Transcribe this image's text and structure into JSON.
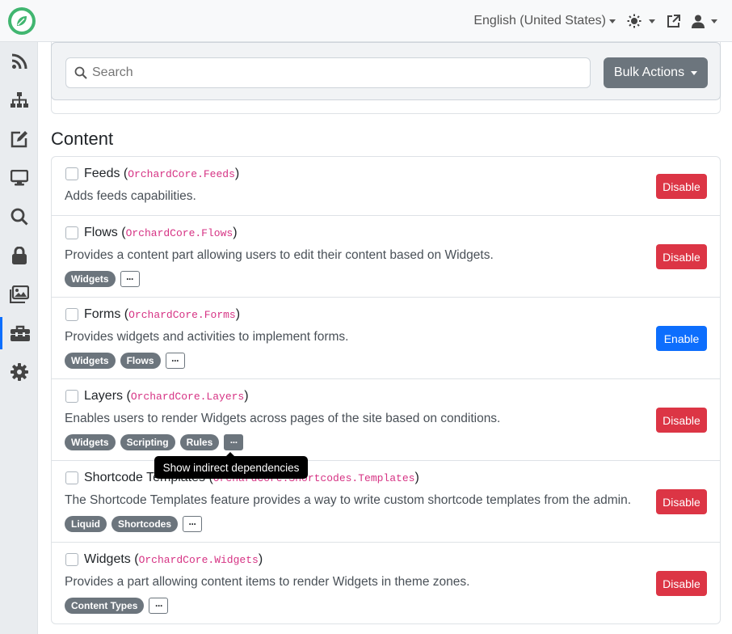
{
  "navbar": {
    "language": "English (United States)",
    "icons": [
      "theme-toggle-icon",
      "external-link-icon",
      "user-icon"
    ]
  },
  "sidebar": {
    "items": [
      {
        "name": "feeds-icon"
      },
      {
        "name": "sitemap-icon"
      },
      {
        "name": "content-edit-icon"
      },
      {
        "name": "design-monitor-icon"
      },
      {
        "name": "search-icon"
      },
      {
        "name": "security-lock-icon"
      },
      {
        "name": "media-images-icon"
      },
      {
        "name": "toolbox-icon",
        "active": true
      },
      {
        "name": "settings-gear-icon"
      }
    ]
  },
  "toolbar": {
    "search_placeholder": "Search",
    "bulk_actions_label": "Bulk Actions"
  },
  "section": {
    "title": "Content"
  },
  "features": [
    {
      "name": "Feeds",
      "id": "OrchardCore.Feeds",
      "description": "Adds feeds capabilities.",
      "dependencies": [],
      "action": "Disable"
    },
    {
      "name": "Flows",
      "id": "OrchardCore.Flows",
      "description": "Provides a content part allowing users to edit their content based on Widgets.",
      "dependencies": [
        "Widgets"
      ],
      "action": "Disable"
    },
    {
      "name": "Forms",
      "id": "OrchardCore.Forms",
      "description": "Provides widgets and activities to implement forms.",
      "dependencies": [
        "Widgets",
        "Flows"
      ],
      "action": "Enable"
    },
    {
      "name": "Layers",
      "id": "OrchardCore.Layers",
      "description": "Enables users to render Widgets across pages of the site based on conditions.",
      "dependencies": [
        "Widgets",
        "Scripting",
        "Rules"
      ],
      "action": "Disable"
    },
    {
      "name": "Shortcode Templates",
      "id": "OrchardCore.Shortcodes.Templates",
      "description": "The Shortcode Templates feature provides a way to write custom shortcode templates from the admin.",
      "dependencies": [
        "Liquid",
        "Shortcodes"
      ],
      "action": "Disable"
    },
    {
      "name": "Widgets",
      "id": "OrchardCore.Widgets",
      "description": "Provides a part allowing content items to render Widgets in theme zones.",
      "dependencies": [
        "Content Types"
      ],
      "action": "Disable"
    }
  ],
  "more_label": "···",
  "tooltip": "Show indirect dependencies",
  "colors": {
    "brand": "#41b670",
    "disable": "#dc3545",
    "enable": "#0d6efd",
    "badge": "#6c757d",
    "code": "#d63384"
  }
}
